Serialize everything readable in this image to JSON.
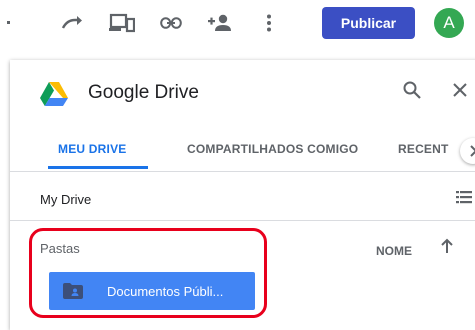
{
  "toolbar": {
    "publish_label": "Publicar",
    "avatar_letter": "A",
    "icons": [
      "redo-icon",
      "preview-devices-icon",
      "link-icon",
      "share-person-icon",
      "more-vert-icon"
    ]
  },
  "dialog": {
    "title": "Google Drive",
    "tabs": [
      {
        "label": "MEU DRIVE",
        "active": true
      },
      {
        "label": "COMPARTILHADOS COMIGO",
        "active": false
      },
      {
        "label": "RECENT",
        "active": false
      }
    ],
    "breadcrumb": "My Drive",
    "section_label": "Pastas",
    "sort_label": "NOME",
    "folders": [
      {
        "name": "Documentos Públi...",
        "selected": true
      }
    ]
  },
  "colors": {
    "accent": "#1a73e8",
    "publish_bg": "#3b4fc4",
    "avatar_bg": "#34a853",
    "selected_bg": "#4285f4",
    "highlight": "#e8001c"
  }
}
